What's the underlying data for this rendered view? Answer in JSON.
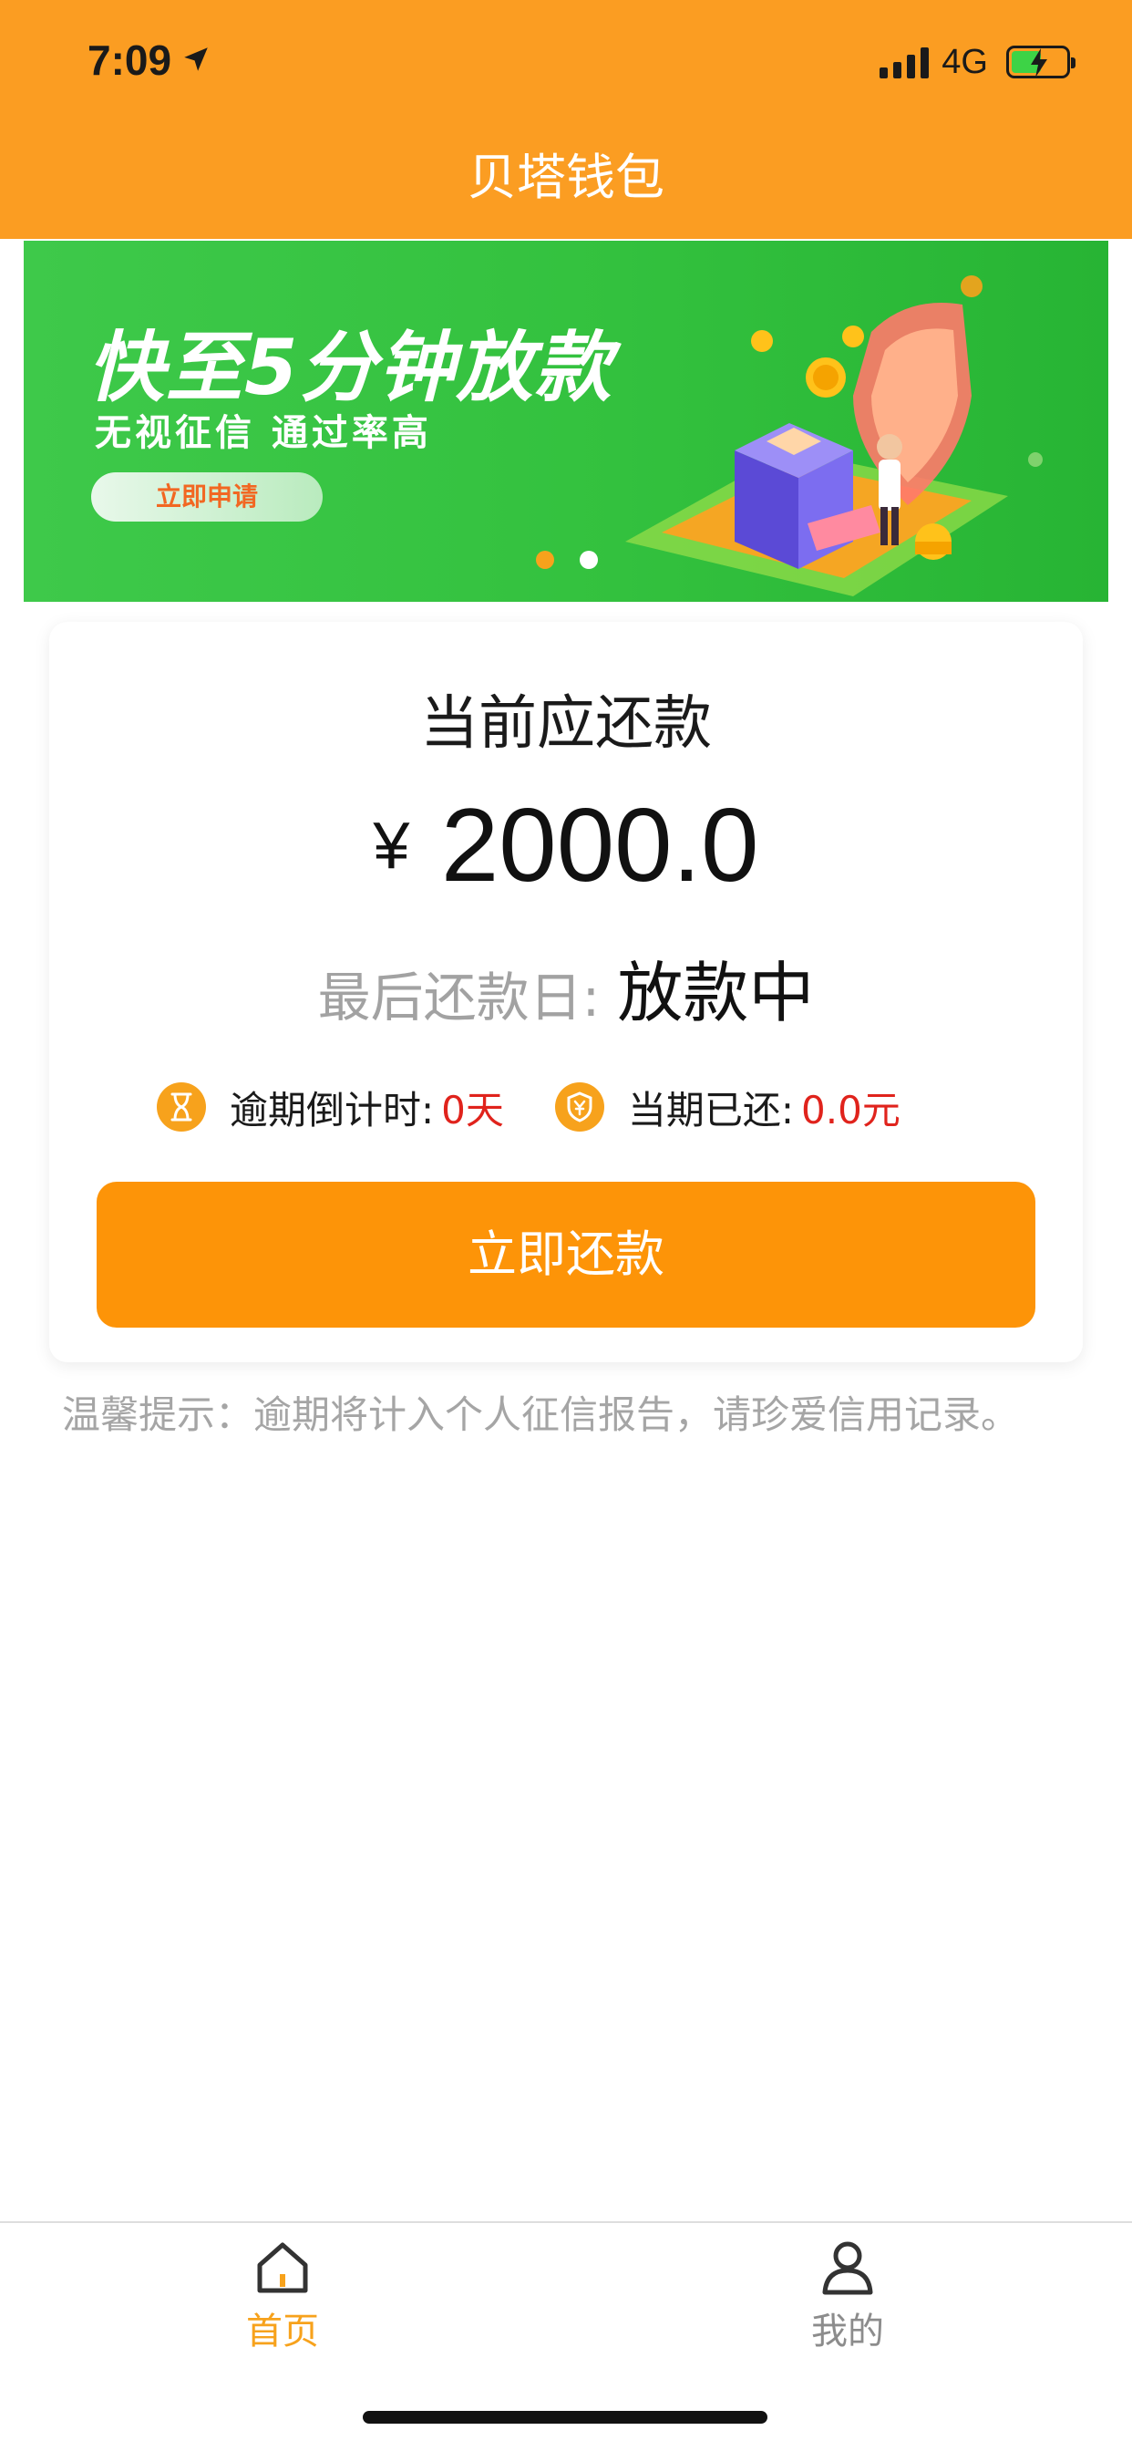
{
  "status_bar": {
    "time": "7:09",
    "network": "4G"
  },
  "header": {
    "title": "贝塔钱包"
  },
  "banner": {
    "headline": "快至5分钟放款",
    "subline": "无视征信  通过率高",
    "cta_label": "立即申请",
    "active_slide": 1,
    "slide_count": 2
  },
  "repayment": {
    "title": "当前应还款",
    "currency_symbol": "¥",
    "amount": "2000.0",
    "due_label": "最后还款日:",
    "due_value": "放款中",
    "overdue_label": "逾期倒计时:",
    "overdue_value": "0天",
    "paid_label": "当期已还:",
    "paid_value": "0.0元",
    "button_label": "立即还款"
  },
  "tip": "温馨提示：逾期将计入个人征信报告，请珍爱信用记录。",
  "tabbar": {
    "items": [
      {
        "label": "首页",
        "icon": "home-icon",
        "active": true
      },
      {
        "label": "我的",
        "icon": "user-icon",
        "active": false
      }
    ]
  },
  "colors": {
    "brand": "#fb9d22",
    "button": "#fd9408",
    "banner_green": "#33c13e",
    "alert_red": "#e0231c",
    "muted_gray": "#a5a5a5"
  }
}
